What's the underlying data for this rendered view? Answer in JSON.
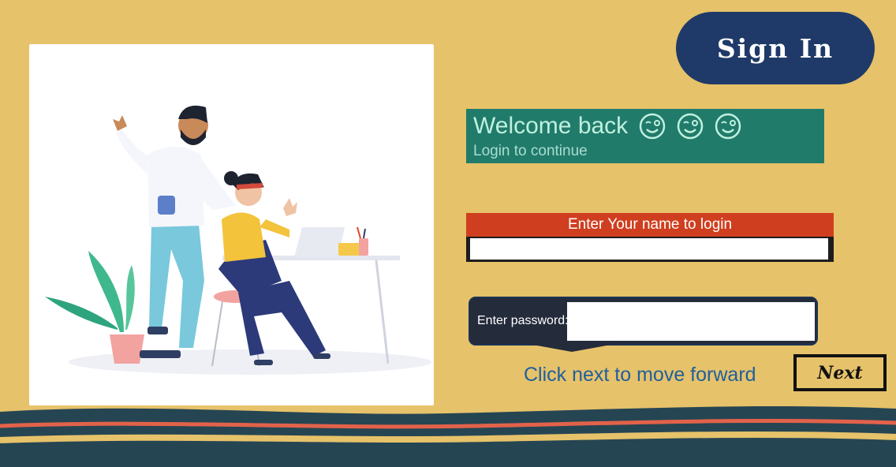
{
  "header": {
    "signin_label": "Sign In"
  },
  "welcome": {
    "title": "Welcome back",
    "subtitle": "Login to continue",
    "emoji_icons": [
      "winking-face-icon",
      "winking-face-icon",
      "winking-face-icon"
    ]
  },
  "name_field": {
    "label": "Enter Your name to login",
    "value": "",
    "placeholder": ""
  },
  "password_field": {
    "label": "Enter password:",
    "value": "",
    "placeholder": ""
  },
  "footer": {
    "hint": "Click next to move forward",
    "next_label": "Next"
  },
  "colors": {
    "background": "#e6c26a",
    "signin_bg": "#1f3a68",
    "welcome_bg": "#217b6b",
    "name_label_bg": "#cf3f1f",
    "password_panel_bg": "#242b3b",
    "hint_text": "#1f5f9e",
    "wave_dark": "#264553",
    "wave_red": "#e2624a"
  },
  "illustration": {
    "icon": "people-at-desk-illustration"
  }
}
